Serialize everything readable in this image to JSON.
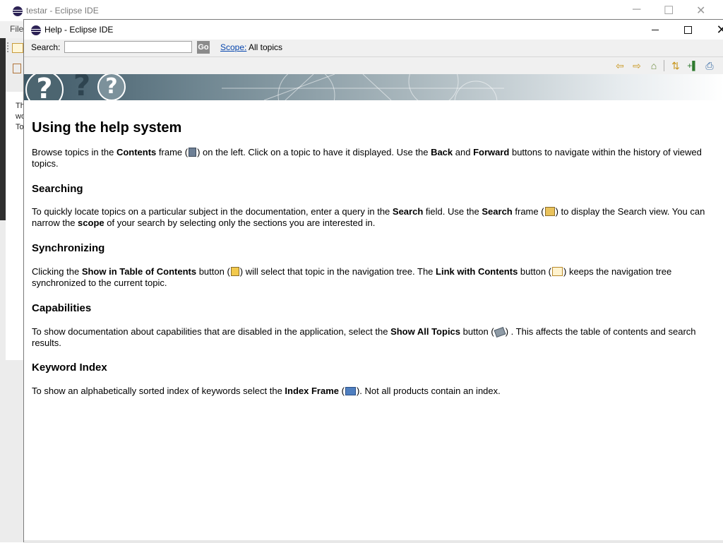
{
  "background_window": {
    "title": "testar - Eclipse IDE",
    "menu_first": "File",
    "sidebar_text": [
      "Th",
      "wo",
      "To"
    ],
    "controls": {
      "minimize": "─",
      "maximize": "☐",
      "close": "✕"
    }
  },
  "help_window": {
    "title": "Help - Eclipse IDE",
    "controls": {
      "close": "✕"
    },
    "search": {
      "label": "Search:",
      "value": "",
      "go_label": "Go",
      "scope_link": "Scope:",
      "scope_value": "All topics"
    },
    "toolbar": {
      "back": "⇦",
      "forward": "⇨",
      "home": "⌂",
      "show_in_toc": "⇅",
      "bookmark": "+▌",
      "print": "⎙"
    }
  },
  "content": {
    "title": "Using the help system",
    "intro": {
      "t1": "Browse topics in the ",
      "b1": "Contents",
      "t2": " frame (",
      "t3": ") on the left. Click on a topic to have it displayed. Use the ",
      "b2": "Back",
      "t4": " and ",
      "b3": "Forward",
      "t5": " buttons to navigate within the history of viewed topics."
    },
    "searching": {
      "heading": "Searching",
      "t1": "To quickly locate topics on a particular subject in the documentation, enter a query in the ",
      "b1": "Search",
      "t2": " field. Use the ",
      "b2": "Search",
      "t3": " frame (",
      "t4": ") to display the Search view. You can narrow the ",
      "b3": "scope",
      "t5": " of your search by selecting only the sections you are interested in."
    },
    "synchronizing": {
      "heading": "Synchronizing",
      "t1": "Clicking the ",
      "b1": "Show in Table of Contents",
      "t2": " button (",
      "t3": ") will select that topic in the navigation tree. The ",
      "b2": "Link with Contents",
      "t4": " button (",
      "t5": ") keeps the navigation tree synchronized to the current topic."
    },
    "capabilities": {
      "heading": "Capabilities",
      "t1": "To show documentation about capabilities that are disabled in the application, select the ",
      "b1": "Show All Topics",
      "t2": " button (",
      "t3": ") . This affects the table of contents and search results."
    },
    "keyword_index": {
      "heading": "Keyword Index",
      "t1": "To show an alphabetically sorted index of keywords select the ",
      "b1": "Index Frame",
      "t2": " (",
      "t3": "). Not all products contain an index."
    }
  }
}
